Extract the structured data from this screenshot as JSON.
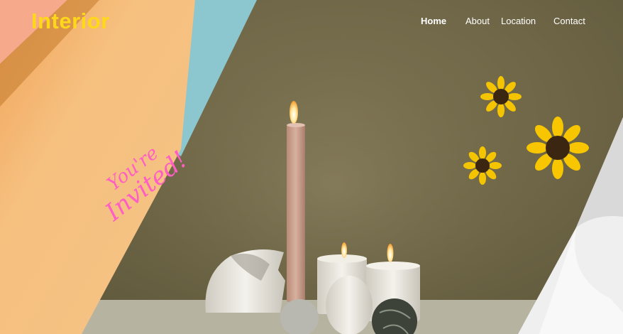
{
  "brand": {
    "logo": "Interior"
  },
  "nav": {
    "items": [
      {
        "label": "Home",
        "active": true
      },
      {
        "label": "About",
        "active": false
      },
      {
        "label": "Location",
        "active": false
      },
      {
        "label": "Contact",
        "active": false
      }
    ]
  },
  "hero": {
    "invitation_line1": "You're",
    "invitation_line2": "Invited!"
  },
  "colors": {
    "logo": "#ffd81a",
    "nav_text": "#ffffff",
    "invitation": "#ff5fc4",
    "backdrop": "#6e6646",
    "paper_orange": "#f6c07f",
    "paper_blue": "#8cc6cf"
  }
}
